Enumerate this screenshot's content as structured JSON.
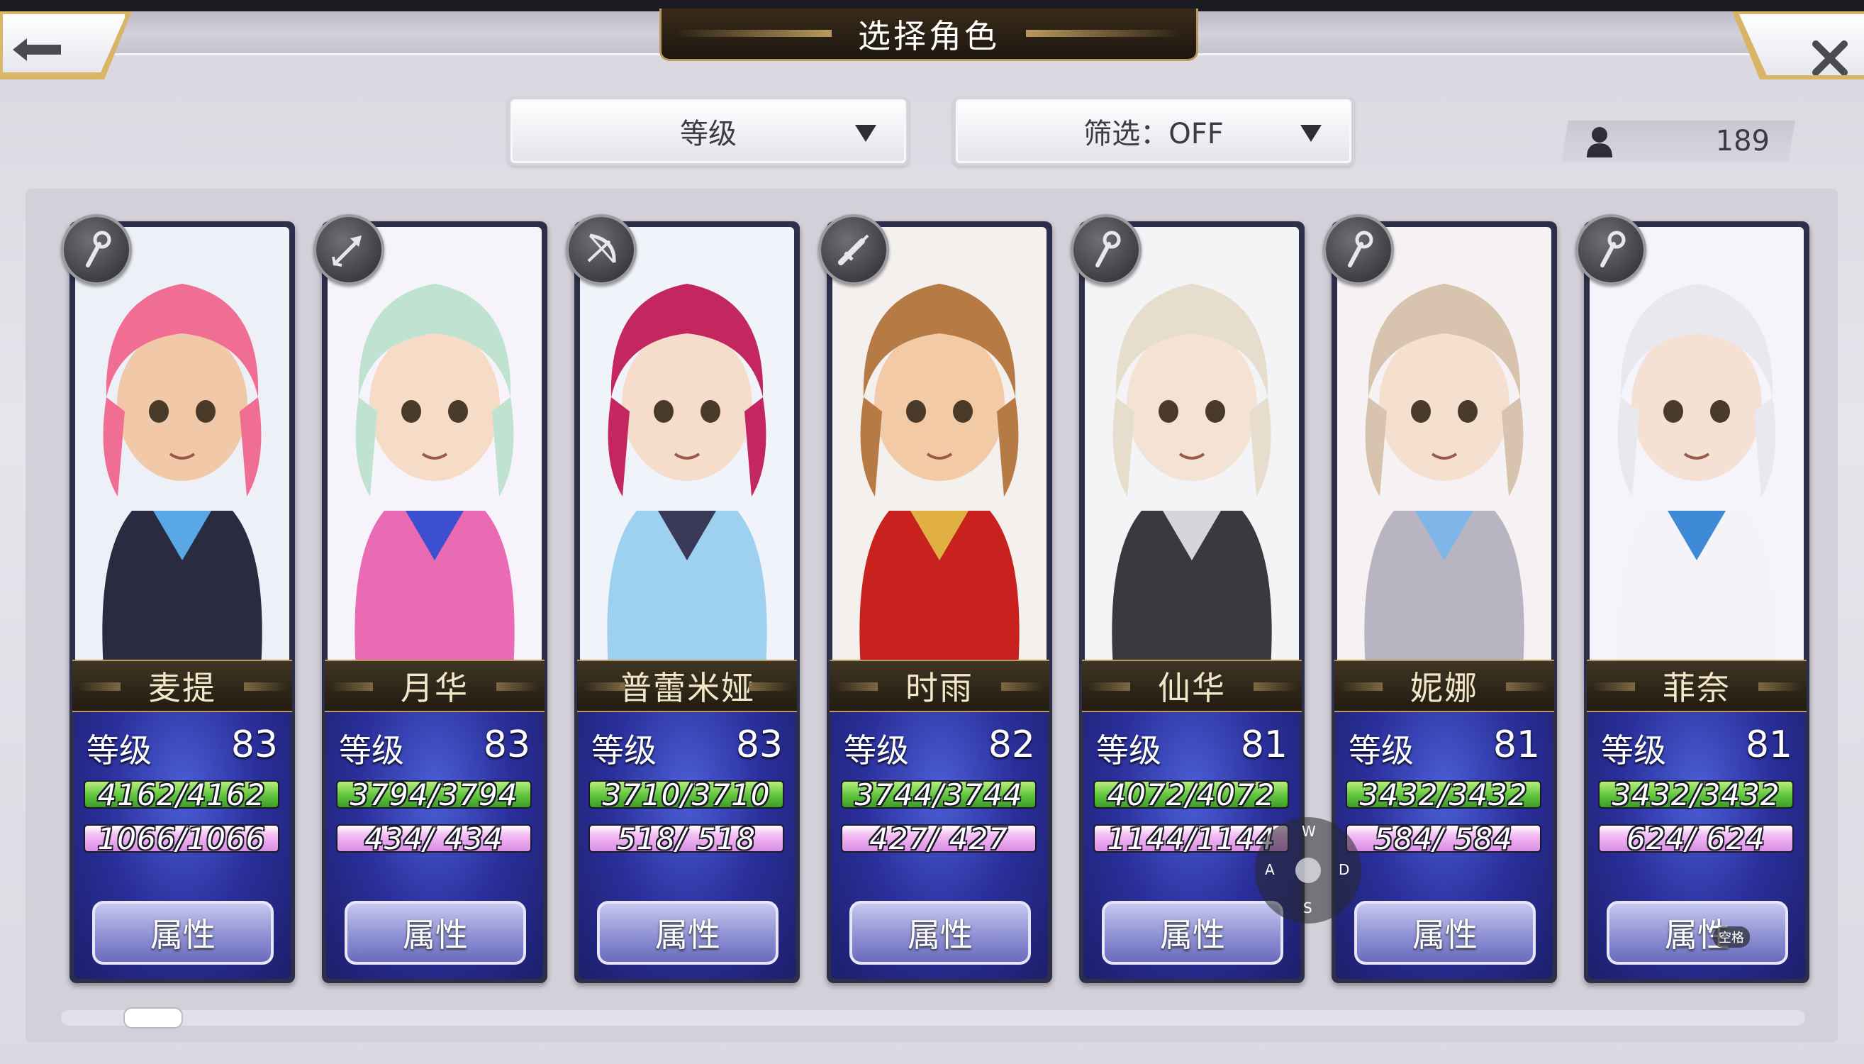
{
  "header": {
    "title": "选择角色",
    "back_icon": "back-arrow-icon",
    "close_icon": "close-icon"
  },
  "sort_dropdown": {
    "label": "等级"
  },
  "filter_dropdown": {
    "label": "筛选：OFF"
  },
  "player_count": {
    "icon": "person-icon",
    "value": "189"
  },
  "colors": {
    "hp_bar": "#5fc43c",
    "mp_bar": "#e6a6ec",
    "stats_bg": "#2a2f9a",
    "name_bar": "#2d2418",
    "gold_trim": "#b89a5e"
  },
  "characters": [
    {
      "name": "麦提",
      "class_icon": "staff-icon",
      "level_label": "等级",
      "level": "83",
      "hp": "4162/4162",
      "mp": "1066/1066",
      "button": "属性"
    },
    {
      "name": "月华",
      "class_icon": "arrow-icon",
      "level_label": "等级",
      "level": "83",
      "hp": "3794/3794",
      "mp": "434/ 434",
      "button": "属性"
    },
    {
      "name": "普蕾米娅",
      "class_icon": "bow-icon",
      "level_label": "等级",
      "level": "83",
      "hp": "3710/3710",
      "mp": "518/ 518",
      "button": "属性"
    },
    {
      "name": "时雨",
      "class_icon": "sword-icon",
      "level_label": "等级",
      "level": "82",
      "hp": "3744/3744",
      "mp": "427/ 427",
      "button": "属性"
    },
    {
      "name": "仙华",
      "class_icon": "staff-icon",
      "level_label": "等级",
      "level": "81",
      "hp": "4072/4072",
      "mp": "1144/1144",
      "button": "属性"
    },
    {
      "name": "妮娜",
      "class_icon": "staff-icon",
      "level_label": "等级",
      "level": "81",
      "hp": "3432/3432",
      "mp": "584/ 584",
      "button": "属性"
    },
    {
      "name": "菲奈",
      "class_icon": "staff-icon",
      "level_label": "等级",
      "level": "81",
      "hp": "3432/3432",
      "mp": "624/ 624",
      "button": "属性"
    }
  ],
  "overlay": {
    "keys": {
      "up": "W",
      "left": "A",
      "right": "D",
      "down": "S"
    },
    "space_key": "空格"
  }
}
